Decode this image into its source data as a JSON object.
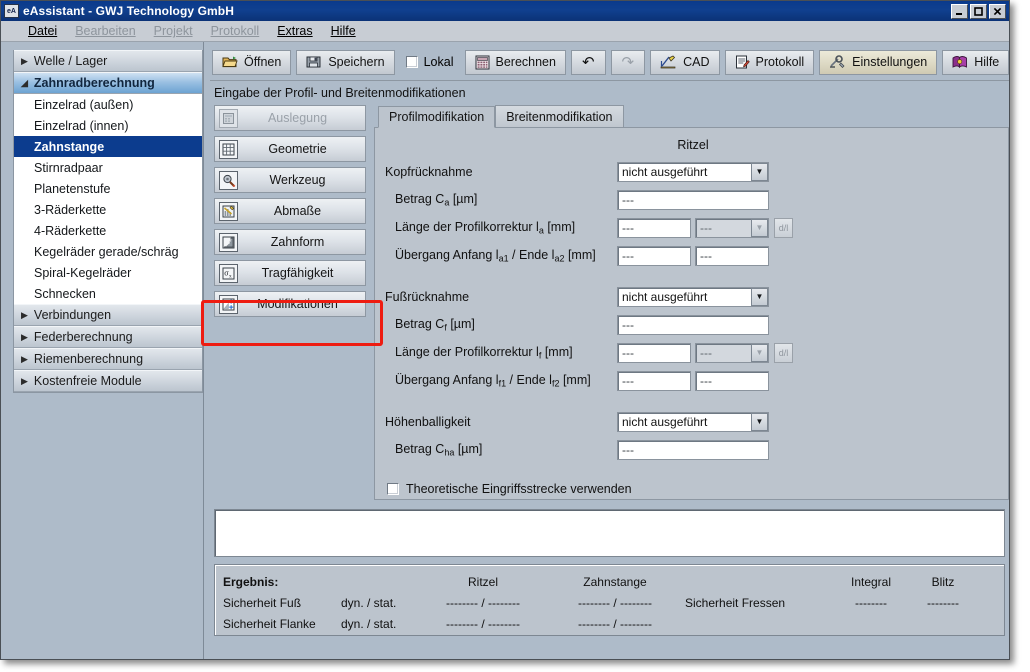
{
  "window": {
    "title": "eAssistant - GWJ Technology GmbH",
    "icon_label": "eA",
    "minimize": "minimize-icon",
    "maximize": "maximize-icon",
    "close": "close-icon"
  },
  "menu": [
    {
      "label": "Datei",
      "disabled": false
    },
    {
      "label": "Bearbeiten",
      "disabled": true
    },
    {
      "label": "Projekt",
      "disabled": true
    },
    {
      "label": "Protokoll",
      "disabled": true
    },
    {
      "label": "Extras",
      "disabled": false
    },
    {
      "label": "Hilfe",
      "disabled": false
    }
  ],
  "sidebar": {
    "groups": [
      {
        "label": "Welle / Lager",
        "expanded": false,
        "arrow": "▶"
      },
      {
        "label": "Zahnradberechnung",
        "expanded": true,
        "arrow": "◢"
      }
    ],
    "items": [
      {
        "label": "Einzelrad (außen)",
        "selected": false
      },
      {
        "label": "Einzelrad (innen)",
        "selected": false
      },
      {
        "label": "Zahnstange",
        "selected": true
      },
      {
        "label": "Stirnradpaar",
        "selected": false
      },
      {
        "label": "Planetenstufe",
        "selected": false
      },
      {
        "label": "3-Räderkette",
        "selected": false
      },
      {
        "label": "4-Räderkette",
        "selected": false
      },
      {
        "label": "Kegelräder gerade/schräg",
        "selected": false
      },
      {
        "label": "Spiral-Kegelräder",
        "selected": false
      },
      {
        "label": "Schnecken",
        "selected": false
      }
    ],
    "groups_after": [
      {
        "label": "Verbindungen",
        "arrow": "▶"
      },
      {
        "label": "Federberechnung",
        "arrow": "▶"
      },
      {
        "label": "Riemenberechnung",
        "arrow": "▶"
      },
      {
        "label": "Kostenfreie Module",
        "arrow": "▶"
      }
    ]
  },
  "toolbar": {
    "open": "Öffnen",
    "save": "Speichern",
    "local": "Lokal",
    "calculate": "Berechnen",
    "undo": "↶",
    "redo": "↷",
    "cad": "CAD",
    "protocol": "Protokoll",
    "settings": "Einstellungen",
    "help": "Hilfe"
  },
  "pane": {
    "title": "Eingabe der Profil- und Breitenmodifikationen"
  },
  "module_buttons": [
    {
      "label": "Auslegung",
      "icon": "calculator-icon",
      "disabled": true
    },
    {
      "label": "Geometrie",
      "icon": "grid-icon",
      "disabled": false
    },
    {
      "label": "Werkzeug",
      "icon": "gear-tool-icon",
      "disabled": false
    },
    {
      "label": "Abmaße",
      "icon": "chart-pencil-icon",
      "disabled": false
    },
    {
      "label": "Zahnform",
      "icon": "tooth-profile-icon",
      "disabled": false
    },
    {
      "label": "Tragfähigkeit",
      "icon": "sigma-x-icon",
      "disabled": false
    },
    {
      "label": "Modifikationen",
      "icon": "modification-icon",
      "disabled": false
    }
  ],
  "tabs": [
    {
      "label": "Profilmodifikation",
      "active": true
    },
    {
      "label": "Breitenmodifikation",
      "active": false
    }
  ],
  "form": {
    "column_header": "Ritzel",
    "dropdown_value": "nicht ausgeführt",
    "empty_value": "---",
    "dl_button": "d/l",
    "sections": [
      {
        "title": "Kopfrücknahme",
        "rows": [
          {
            "label_html": "Betrag C<sub>a</sub> [µm]",
            "type": "input-full"
          },
          {
            "label_html": "Länge der Profilkorrektur l<sub>a</sub> [mm]",
            "type": "input-half-combo-dl"
          },
          {
            "label_html": "Übergang Anfang l<sub>a1</sub> / Ende l<sub>a2</sub> [mm]",
            "type": "input-half-half"
          }
        ]
      },
      {
        "title": "Fußrücknahme",
        "rows": [
          {
            "label_html": "Betrag C<sub>f</sub> [µm]",
            "type": "input-full"
          },
          {
            "label_html": "Länge der Profilkorrektur l<sub>f</sub> [mm]",
            "type": "input-half-combo-dl"
          },
          {
            "label_html": "Übergang Anfang l<sub>f1</sub> / Ende l<sub>f2</sub> [mm]",
            "type": "input-half-half"
          }
        ]
      },
      {
        "title": "Höhenballigkeit",
        "rows": [
          {
            "label_html": "Betrag C<sub>ha</sub> [µm]",
            "type": "input-full"
          }
        ]
      }
    ],
    "checkbox_label": "Theoretische Eingriffsstrecke verwenden",
    "checkbox_checked": false
  },
  "result": {
    "title": "Ergebnis:",
    "header_ritzel": "Ritzel",
    "header_zahnstange": "Zahnstange",
    "header_integral": "Integral",
    "header_blitz": "Blitz",
    "rows": [
      {
        "label": "Sicherheit Fuß",
        "mode": "dyn. / stat.",
        "ritzel": "-------- / --------",
        "zahnstange": "-------- / --------",
        "fressen_label": "Sicherheit Fressen",
        "integral": "--------",
        "blitz": "--------"
      },
      {
        "label": "Sicherheit Flanke",
        "mode": "dyn. / stat.",
        "ritzel": "-------- / --------",
        "zahnstange": "-------- / --------",
        "fressen_label": "",
        "integral": "",
        "blitz": ""
      }
    ]
  },
  "annotation": {
    "highlight_target": "Modifikationen",
    "color": "#ee1c11"
  }
}
